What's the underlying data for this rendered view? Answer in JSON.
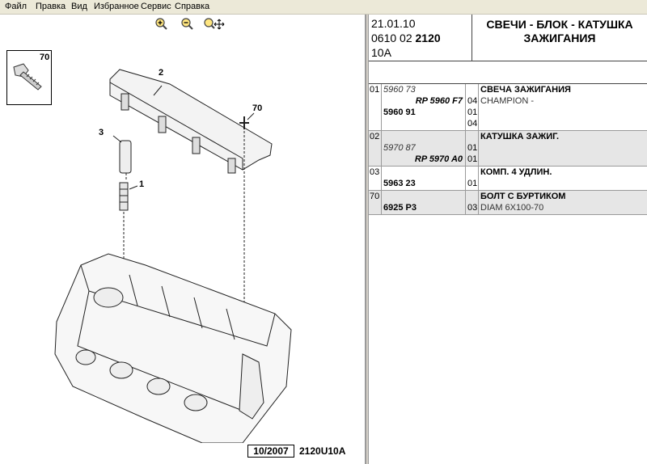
{
  "menu": [
    "Файл",
    "Правка",
    "Вид",
    "Избранное",
    "Сервис",
    "Справка"
  ],
  "zoom_tools": [
    "zoom-in-icon",
    "zoom-out-icon",
    "zoom-pan-icon"
  ],
  "header": {
    "date": "21.01.10",
    "catalog_prefix": "0610 02 ",
    "catalog_code": "2120",
    "engine": "10A",
    "title_line1": "СВЕЧИ - БЛОК - КАТУШКА",
    "title_line2": "ЗАЖИГАНИЯ"
  },
  "parts": [
    {
      "num": "01",
      "refs": [
        "5960 73",
        "RP 5960 F7",
        "5960 91"
      ],
      "qtys": [
        "04",
        "01",
        "04"
      ],
      "desc": "СВЕЧА ЗАЖИГАНИЯ",
      "desc_sub": "CHAMPION -"
    },
    {
      "num": "02",
      "refs": [
        "5970 87",
        "RP 5970 A0"
      ],
      "qtys": [
        "01",
        "01"
      ],
      "desc": "КАТУШКА ЗАЖИГ.",
      "desc_sub": ""
    },
    {
      "num": "03",
      "refs": [
        "5963 23"
      ],
      "qtys": [
        "01"
      ],
      "desc": "КОМП. 4 УДЛИН.",
      "desc_sub": ""
    },
    {
      "num": "70",
      "refs": [
        "6925 P3"
      ],
      "qtys": [
        "03"
      ],
      "desc": "БОЛТ С БУРТИКОМ",
      "desc_sub": "DIAM 6X100-70"
    }
  ],
  "diagram": {
    "callouts": [
      "70",
      "2",
      "3",
      "1",
      "70"
    ],
    "footer_date": "10/2007",
    "footer_code": "2120U10A"
  },
  "colors": {
    "menubar": "#ece9d8",
    "row_shade": "#e6e6e6"
  }
}
